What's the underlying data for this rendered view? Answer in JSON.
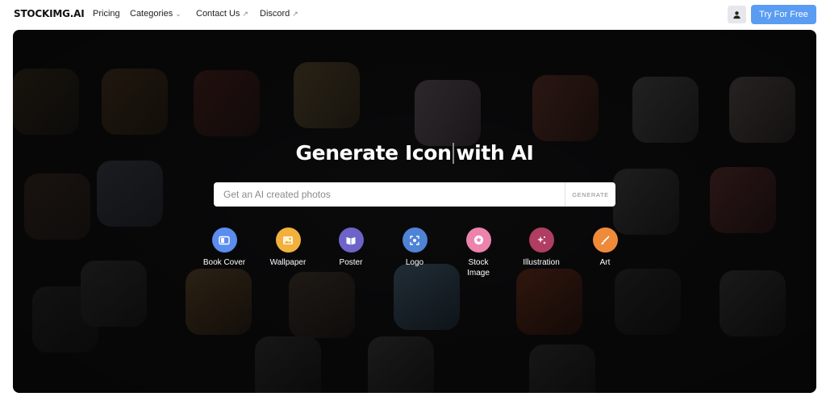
{
  "nav": {
    "brand": "STOCKIMG.AI",
    "links": [
      {
        "label": "Pricing",
        "icon": ""
      },
      {
        "label": "Categories",
        "icon": "chevron-down-icon"
      },
      {
        "label": "Contact Us",
        "icon": "external-link-icon"
      },
      {
        "label": "Discord",
        "icon": "external-link-icon"
      }
    ],
    "user_icon": "user-icon",
    "cta": "Try For Free"
  },
  "hero": {
    "headline_before": "Generate Icon",
    "headline_after": "with AI",
    "search_placeholder": "Get an AI created photos",
    "generate_label": "GENERATE",
    "categories": [
      {
        "label": "Book Cover",
        "color": "#5b8def",
        "icon": "book-icon"
      },
      {
        "label": "Wallpaper",
        "color": "#f2b13d",
        "icon": "image-icon"
      },
      {
        "label": "Poster",
        "color": "#6e63c9",
        "icon": "poster-icon"
      },
      {
        "label": "Logo",
        "color": "#4f83d6",
        "icon": "logo-icon"
      },
      {
        "label": "Stock\nImage",
        "color": "#ec83ac",
        "icon": "star-icon"
      },
      {
        "label": "Illustration",
        "color": "#b03d62",
        "icon": "sparkle-icon"
      },
      {
        "label": "Art",
        "color": "#ef8a3a",
        "icon": "brush-icon"
      }
    ]
  },
  "colors": {
    "accent": "#5a9cf2",
    "hero_bg": "#101012"
  }
}
